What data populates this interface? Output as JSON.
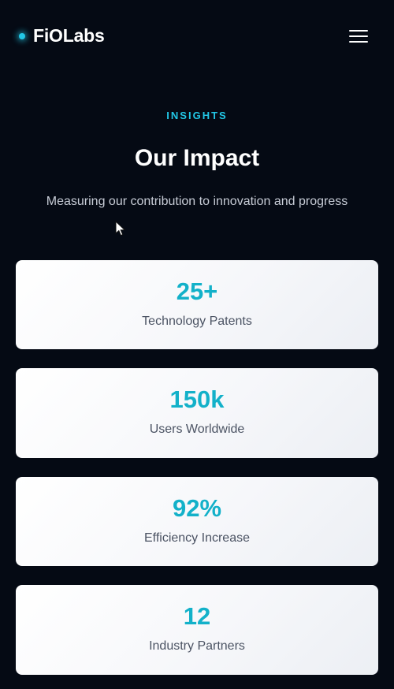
{
  "header": {
    "brand": "FiOLabs",
    "menu_icon": "hamburger-menu-icon"
  },
  "section": {
    "eyebrow": "INSIGHTS",
    "title": "Our Impact",
    "subtitle": "Measuring our contribution to innovation and progress"
  },
  "stats": [
    {
      "value": "25+",
      "label": "Technology Patents"
    },
    {
      "value": "150k",
      "label": "Users Worldwide"
    },
    {
      "value": "92%",
      "label": "Efficiency Increase"
    },
    {
      "value": "12",
      "label": "Industry Partners"
    }
  ],
  "colors": {
    "background": "#050a14",
    "accent": "#22c7e6",
    "stat_value": "#13b1c9",
    "card": "#f6f7fa",
    "label": "#4b5363"
  }
}
